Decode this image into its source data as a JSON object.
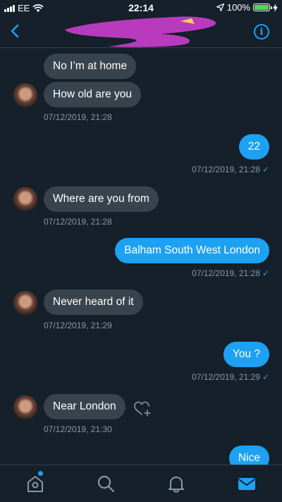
{
  "status_bar": {
    "carrier": "EE",
    "time": "22:14",
    "battery": "100%"
  },
  "colors": {
    "background": "#15202b",
    "accent": "#1da1f2",
    "incoming_bubble": "#38444d",
    "timestamp": "#8899a6"
  },
  "messages": [
    {
      "dir": "in",
      "text": "No I’m at home"
    },
    {
      "dir": "in",
      "text": "How old are you",
      "time": "07/12/2019, 21:28"
    },
    {
      "dir": "out",
      "text": "22",
      "time": "07/12/2019, 21:28"
    },
    {
      "dir": "in",
      "text": "Where are you from",
      "time": "07/12/2019, 21:28"
    },
    {
      "dir": "out",
      "text": "Balham South West London",
      "time": "07/12/2019, 21:28"
    },
    {
      "dir": "in",
      "text": "Never heard of it",
      "time": "07/12/2019, 21:29"
    },
    {
      "dir": "out",
      "text": "You ?",
      "time": "07/12/2019, 21:29"
    },
    {
      "dir": "in",
      "text": "Near London",
      "time": "07/12/2019, 21:30"
    },
    {
      "dir": "out",
      "text": "Nice"
    }
  ],
  "read_mark": "✓",
  "tabbar": {
    "items": [
      "home-icon",
      "search-icon",
      "notifications-icon",
      "messages-icon"
    ],
    "active": "messages-icon"
  }
}
